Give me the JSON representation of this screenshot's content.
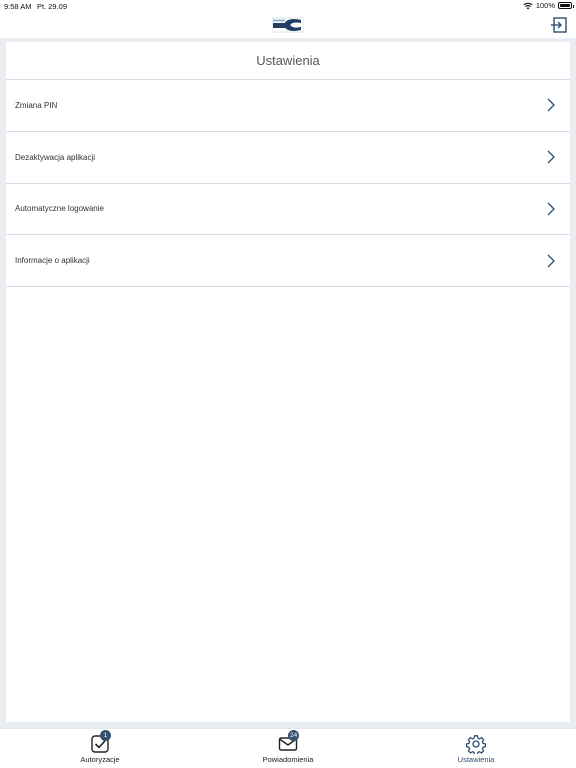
{
  "status_bar": {
    "time": "9:58 AM",
    "date": "Pt. 29.09",
    "battery": "100%"
  },
  "header": {
    "logo_icon": "bank-logo-icon",
    "logout_icon": "logout-icon"
  },
  "page": {
    "title": "Ustawienia"
  },
  "settings": {
    "items": [
      {
        "label": "Zmiana PIN",
        "icon": "chevron-right-icon"
      },
      {
        "label": "Dezaktywacja aplikacji",
        "icon": "chevron-right-icon"
      },
      {
        "label": "Automatyczne logowanie",
        "icon": "chevron-right-icon"
      },
      {
        "label": "Informacje o aplikacji",
        "icon": "chevron-right-icon"
      }
    ]
  },
  "tabs": [
    {
      "label": "Autoryzacje",
      "icon": "checkbox-icon",
      "badge": "1",
      "active": false
    },
    {
      "label": "Powiadomienia",
      "icon": "envelope-icon",
      "badge": "24",
      "active": false
    },
    {
      "label": "Ustawienia",
      "icon": "gear-icon",
      "badge": "",
      "active": true
    }
  ],
  "colors": {
    "accent": "#2c4f73",
    "badge": "#35506d",
    "frame": "#e9ecf0",
    "divider": "#d9dde2"
  }
}
